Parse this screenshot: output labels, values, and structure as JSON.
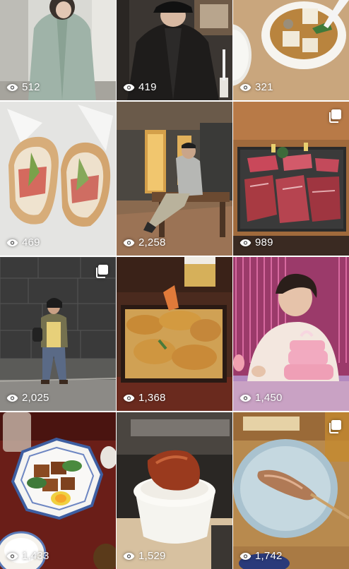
{
  "grid": {
    "tiles": [
      {
        "views": "512",
        "multi": false,
        "subject": "person-in-green-cardigan"
      },
      {
        "views": "419",
        "multi": false,
        "subject": "person-in-black-cap-jacket"
      },
      {
        "views": "321",
        "multi": false,
        "subject": "tofu-soup-bowl"
      },
      {
        "views": "469",
        "multi": false,
        "subject": "sandwich-halves"
      },
      {
        "views": "2,258",
        "multi": false,
        "subject": "person-sitting-on-bench"
      },
      {
        "views": "989",
        "multi": true,
        "subject": "raw-wagyu-platter"
      },
      {
        "views": "2,025",
        "multi": true,
        "subject": "person-by-stone-wall"
      },
      {
        "views": "1,368",
        "multi": false,
        "subject": "tempura-rice-box"
      },
      {
        "views": "1,450",
        "multi": false,
        "subject": "person-with-pink-cake"
      },
      {
        "views": "1,433",
        "multi": false,
        "subject": "braised-pork-plate"
      },
      {
        "views": "1,529",
        "multi": false,
        "subject": "meat-on-rice-bowl"
      },
      {
        "views": "1,742",
        "multi": true,
        "subject": "yakitori-skewer-plate"
      }
    ]
  },
  "icons": {
    "views": "eye-icon",
    "multi": "carousel-icon"
  }
}
